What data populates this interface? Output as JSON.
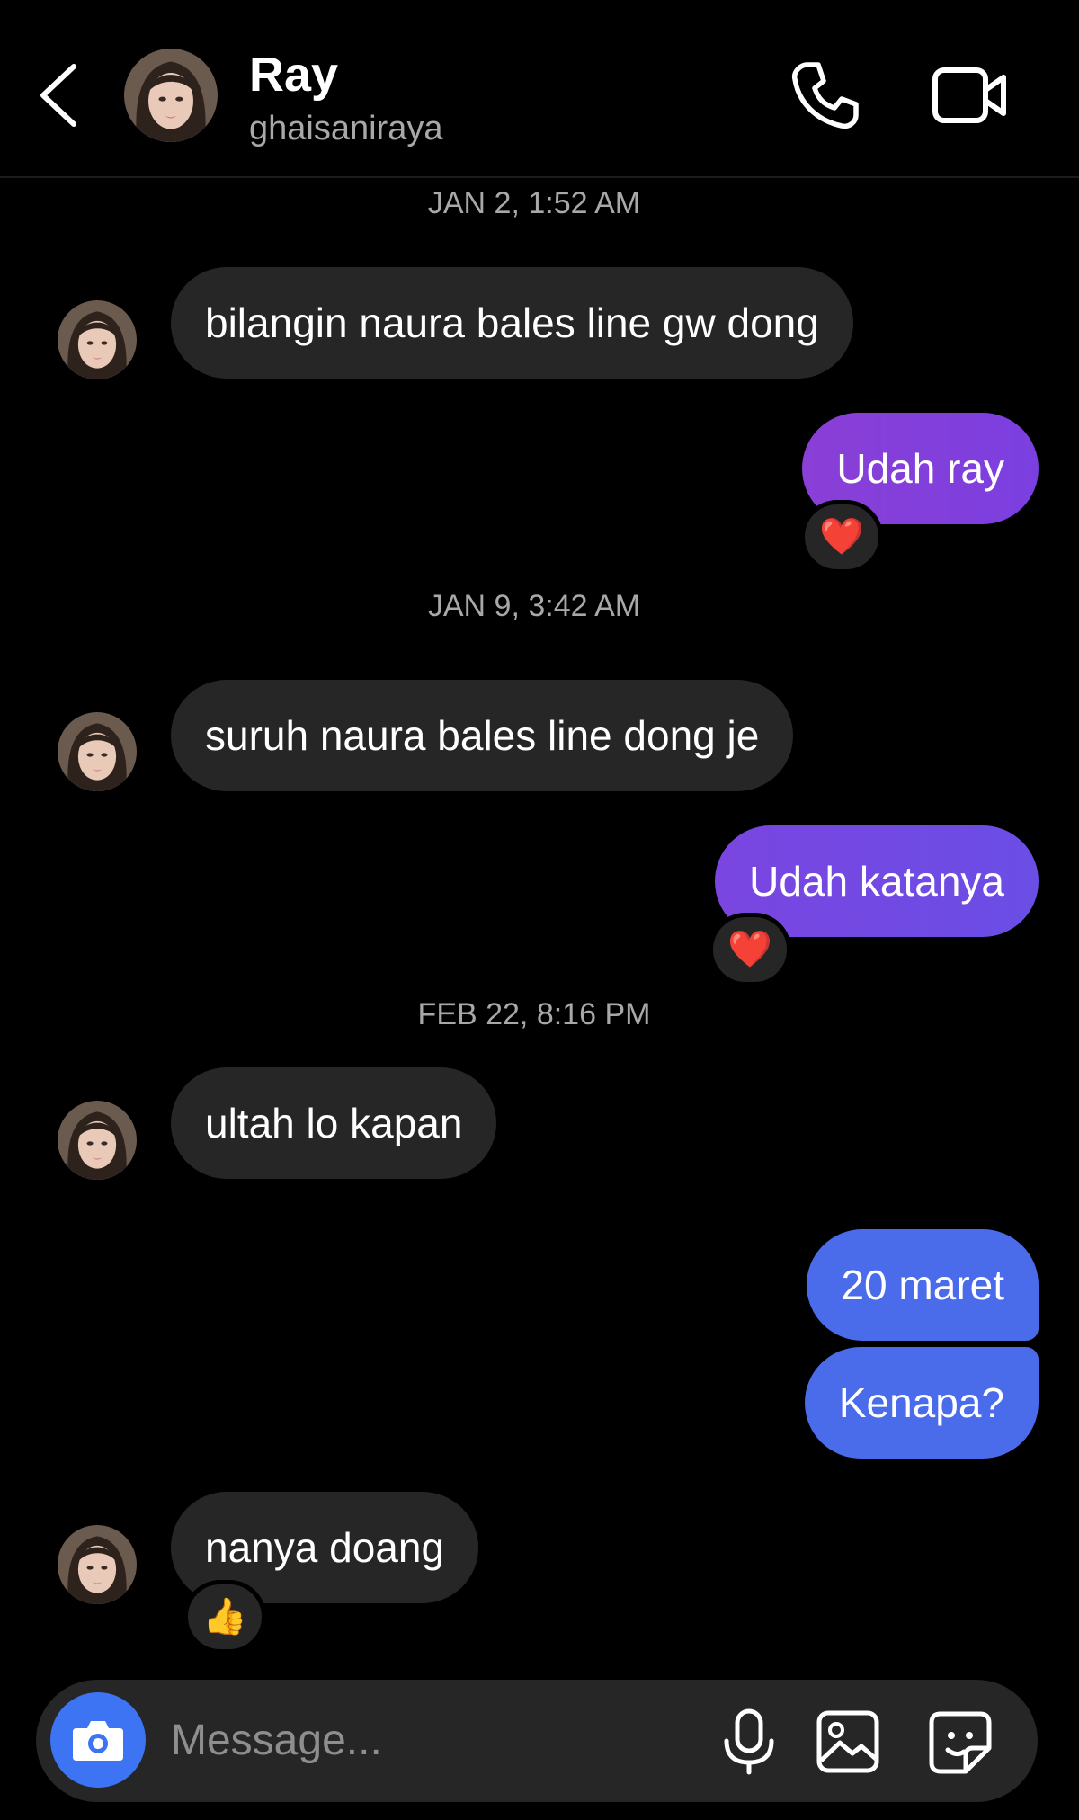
{
  "header": {
    "name": "Ray",
    "username": "ghaisaniraya",
    "icons": [
      "back-chevron",
      "avatar",
      "phone",
      "video-camera"
    ]
  },
  "timestamps": [
    "JAN 2, 1:52 AM",
    "JAN 9, 3:42 AM",
    "FEB 22, 8:16 PM"
  ],
  "messages": [
    {
      "from": "them",
      "text": "bilangin naura bales line gw dong"
    },
    {
      "from": "me",
      "text": "Udah ray",
      "reaction": "❤️"
    },
    {
      "from": "them",
      "text": "suruh naura bales line dong je"
    },
    {
      "from": "me",
      "text": "Udah katanya",
      "reaction": "❤️"
    },
    {
      "from": "them",
      "text": "ultah lo kapan"
    },
    {
      "from": "me",
      "text": "20 maret"
    },
    {
      "from": "me",
      "text": "Kenapa?"
    },
    {
      "from": "them",
      "text": "nanya doang",
      "reaction": "👍"
    }
  ],
  "composer": {
    "placeholder": "Message...",
    "icons": [
      "camera",
      "microphone",
      "gallery",
      "sticker"
    ]
  },
  "colors": {
    "background": "#000000",
    "incoming_bubble": "#262626",
    "outgoing_purple": "#8a3fd6",
    "outgoing_violet": "#7a45e0",
    "outgoing_blue": "#4a6bea",
    "camera_button": "#3c74f3"
  }
}
